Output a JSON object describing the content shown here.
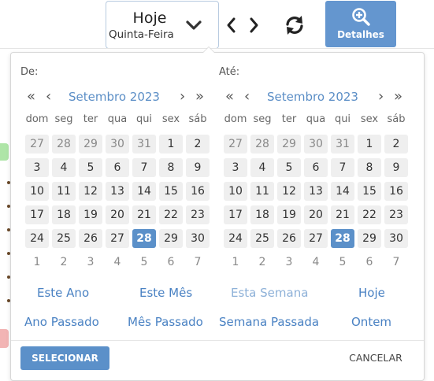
{
  "toolbar": {
    "date_main": "Hoje",
    "date_sub": "Quinta-Feira",
    "details_label": "Detalhes"
  },
  "from_calendar": {
    "label": "De:",
    "month_title": "Setembro 2023",
    "weekdays": [
      "dom",
      "seg",
      "ter",
      "qua",
      "qui",
      "sex",
      "sáb"
    ],
    "weeks": [
      [
        "27",
        "28",
        "29",
        "30",
        "31",
        "1",
        "2"
      ],
      [
        "3",
        "4",
        "5",
        "6",
        "7",
        "8",
        "9"
      ],
      [
        "10",
        "11",
        "12",
        "13",
        "14",
        "15",
        "16"
      ],
      [
        "17",
        "18",
        "19",
        "20",
        "21",
        "22",
        "23"
      ],
      [
        "24",
        "25",
        "26",
        "27",
        "28",
        "29",
        "30"
      ],
      [
        "1",
        "2",
        "3",
        "4",
        "5",
        "6",
        "7"
      ]
    ],
    "selected_day": "28"
  },
  "to_calendar": {
    "label": "Até:",
    "month_title": "Setembro 2023",
    "weekdays": [
      "dom",
      "seg",
      "ter",
      "qua",
      "qui",
      "sex",
      "sáb"
    ],
    "weeks": [
      [
        "27",
        "28",
        "29",
        "30",
        "31",
        "1",
        "2"
      ],
      [
        "3",
        "4",
        "5",
        "6",
        "7",
        "8",
        "9"
      ],
      [
        "10",
        "11",
        "12",
        "13",
        "14",
        "15",
        "16"
      ],
      [
        "17",
        "18",
        "19",
        "20",
        "21",
        "22",
        "23"
      ],
      [
        "24",
        "25",
        "26",
        "27",
        "28",
        "29",
        "30"
      ],
      [
        "1",
        "2",
        "3",
        "4",
        "5",
        "6",
        "7"
      ]
    ],
    "selected_day": "28"
  },
  "ranges": {
    "this_year": "Este Ano",
    "this_month": "Este Mês",
    "this_week": "Esta Semana",
    "today": "Hoje",
    "last_year": "Ano Passado",
    "last_month": "Mês Passado",
    "last_week": "Semana Passada",
    "yesterday": "Ontem"
  },
  "actions": {
    "select": "SELECIONAR",
    "cancel": "CANCELAR"
  },
  "colors": {
    "accent": "#5b90c9",
    "link": "#4a82c3",
    "details_button": "#6496cf"
  }
}
